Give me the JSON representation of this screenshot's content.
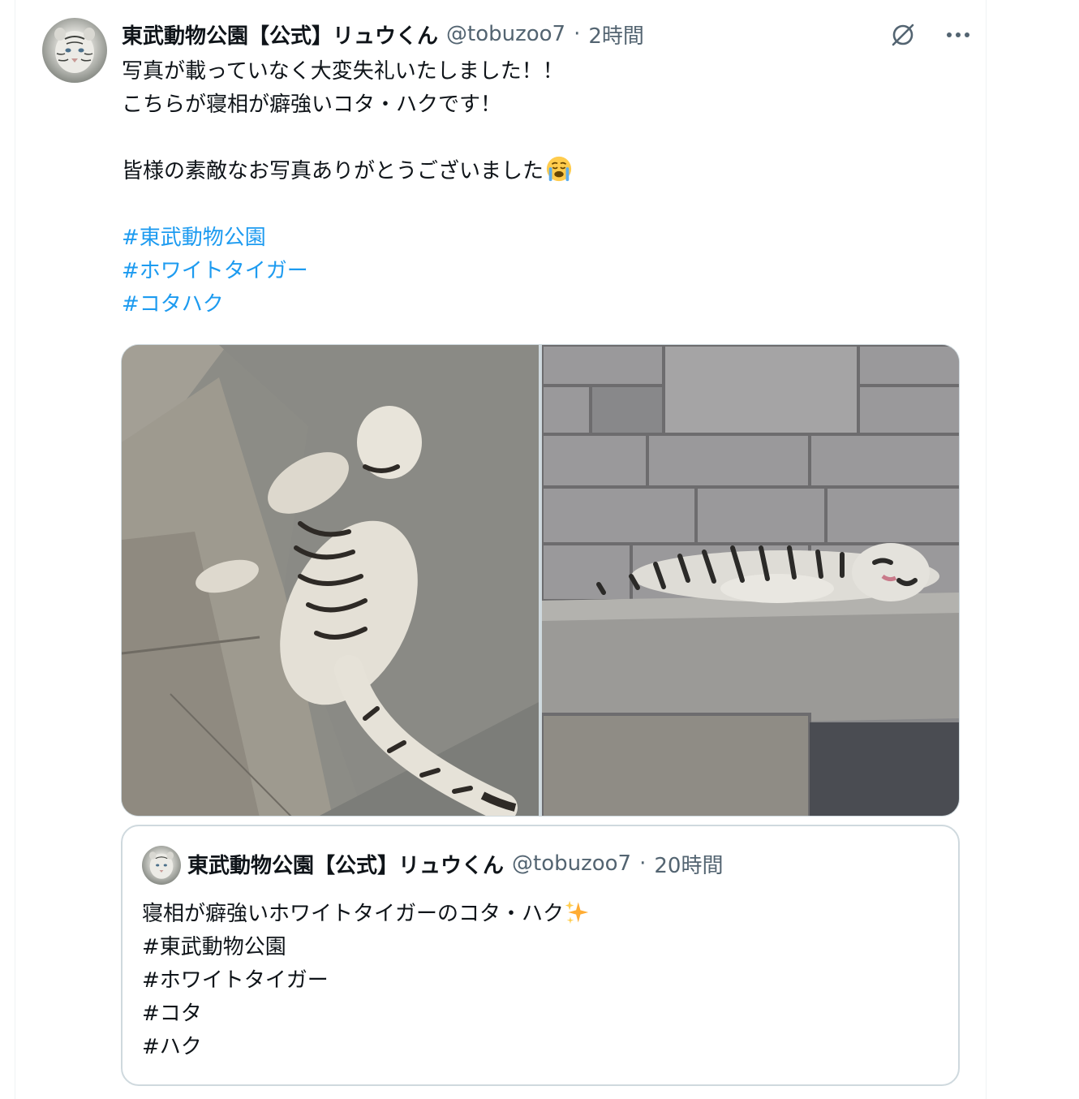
{
  "tweet": {
    "display_name": "東武動物公園【公式】リュウくん",
    "handle": "@tobuzoo7",
    "separator": "·",
    "time": "2時間",
    "lines": [
      "写真が載っていなく大変失礼いたしました！！",
      "こちらが寝相が癖強いコタ・ハクです！",
      "",
      "皆様の素敵なお写真ありがとうございました"
    ],
    "hashtags": [
      "#東武動物公園",
      "#ホワイトタイガー",
      "#コタハク"
    ],
    "emoji": "crying-face",
    "media_count": 2
  },
  "actions": {
    "icons": [
      "grok-icon",
      "more-icon"
    ]
  },
  "quote": {
    "display_name": "東武動物公園【公式】リュウくん",
    "handle": "@tobuzoo7",
    "separator": "·",
    "time": "20時間",
    "line1": "寝相が癖強いホワイトタイガーのコタ・ハク",
    "emoji": "sparkles",
    "hashtags": [
      "#東武動物公園",
      "#ホワイトタイガー",
      "#コタ",
      "#ハク"
    ]
  },
  "colors": {
    "text": "#0f1419",
    "secondary": "#536471",
    "link": "#1d9bf0",
    "border": "#cfd9de"
  }
}
